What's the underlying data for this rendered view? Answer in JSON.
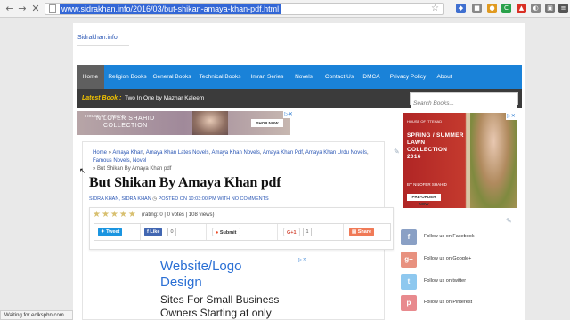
{
  "browser": {
    "url": "www.sidrakhan.info/2016/03/but-shikan-amaya-khan-pdf.html",
    "status": "Waiting for eclkspbn.com...",
    "icons": [
      "back-icon",
      "forward-icon",
      "reload-icon",
      "page-icon",
      "bookmark-star-icon"
    ]
  },
  "site": {
    "title": "Sidrakhan.info"
  },
  "menu": [
    "Home",
    "Religion Books",
    "General Books",
    "Technical Books",
    "Imran Series",
    "Novels",
    "Contact Us",
    "DMCA",
    "Privacy Policy",
    "About"
  ],
  "ticker": {
    "label": "Latest Book :",
    "text": "Two In One by Mazhar Kaleem"
  },
  "search": {
    "placeholder": "Search Books..."
  },
  "banner_ad": {
    "house": "HOUSE OF ITTEHAD",
    "brand_line1": "NILOFER SHAHID",
    "brand_line2": "COLLECTION",
    "cta": "SHOP NOW"
  },
  "post": {
    "breadcrumb": {
      "home": "Home",
      "sep": " » ",
      "items": [
        "Amaya Khan",
        "Amaya Khan Lates Novels",
        "Amaya Khan Novels",
        "Amaya Khan Pdf",
        "Amaya Khan Urdu Novels",
        "Famous Novels",
        "Novel"
      ],
      "current": "But Shikan By Amaya Khan pdf"
    },
    "title": "But Shikan By Amaya Khan pdf",
    "meta": {
      "authors": "SIDRA KHAN, SIDRA KHAN",
      "posted": "POSTED ON 10:03:00 PM WITH NO COMMENTS"
    },
    "rating": {
      "stars": "★★★★★",
      "text": "(rating: 0 | 0 votes | 108 views)",
      "value": 0
    },
    "share": {
      "tweet": "Tweet",
      "like": "Like",
      "like_count": "0",
      "submit": "Submit",
      "gplus": "G+1",
      "gplus_count": "1",
      "share": "Share"
    }
  },
  "text_ad": {
    "heading_line1": "Website/Logo",
    "heading_line2": "Design",
    "sub_line1": "Sites For Small Business",
    "sub_line2": "Owners Starting at only"
  },
  "side_ad": {
    "house": "HOUSE OF ITTEHAD",
    "line1": "SPRING / SUMMER",
    "line2": "LAWN",
    "line3": "COLLECTION",
    "line4": "2016",
    "byline": "BY NILOFER SHAHID",
    "cta": "PRE-ORDER NOW"
  },
  "follow": [
    {
      "label": "Follow us on Facebook",
      "glyph": "f",
      "color": "#3b5998"
    },
    {
      "label": "Follow us on Google+",
      "glyph": "g+",
      "color": "#dd4b39"
    },
    {
      "label": "Follow us on twitter",
      "glyph": "t",
      "color": "#55acee"
    },
    {
      "label": "Follow us on Pinterest",
      "glyph": "p",
      "color": "#cb2027"
    }
  ],
  "colors": {
    "menu": "#1a82d8",
    "menu_active": "#5f5f5f",
    "ticker": "#3b3b3b",
    "ticker_label": "#f3c400",
    "link": "#2a56b4"
  }
}
